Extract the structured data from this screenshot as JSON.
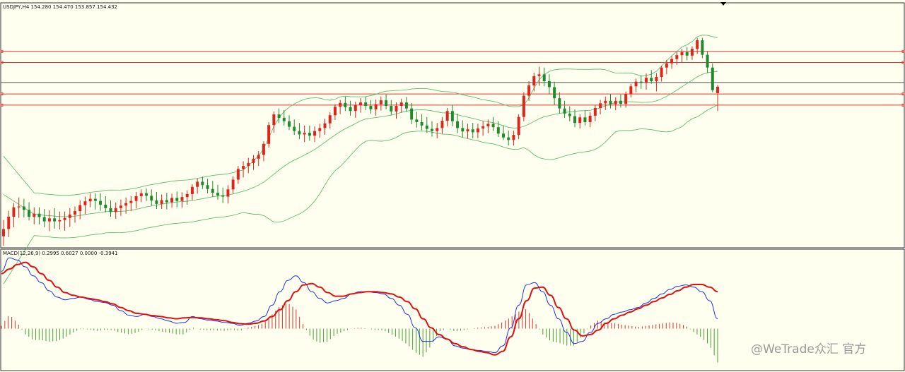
{
  "header": {
    "info": "USDJPY,H4  154.280 154.470 153.857 154.432"
  },
  "macd_label": "MACD(12,26,9) 0.2995 0.6027 0.0000 -0.3941",
  "watermark": "@WeTrade众汇 官方",
  "colors": {
    "background": "#FFFFF0",
    "bull": "#E0241B",
    "bear": "#1E8A2E",
    "band": "#5DBE6E",
    "level": "#E03030",
    "last_price": "#555555",
    "signal": "#E01010",
    "macd_line": "#2030E0",
    "hist_up": "#E03030",
    "hist_down": "#40A030"
  },
  "chart_data": [
    {
      "type": "candlestick",
      "symbol": "USDJPY",
      "timeframe": "H4",
      "ohlc_last": {
        "open": 154.28,
        "high": 154.47,
        "low": 153.857,
        "close": 154.432
      },
      "ylim": [
        150.7,
        156.3
      ],
      "overlays": [
        "bollinger-bands"
      ],
      "horizontal_levels": [
        155.26,
        155.0,
        154.26,
        154.0
      ],
      "last_price_line": 154.53,
      "candles": [
        [
          150.92,
          151.3,
          150.7,
          151.09
        ],
        [
          151.09,
          151.52,
          150.9,
          151.38
        ],
        [
          151.38,
          151.7,
          151.13,
          151.6
        ],
        [
          151.6,
          151.83,
          151.35,
          151.62
        ],
        [
          151.62,
          151.8,
          151.36,
          151.54
        ],
        [
          151.54,
          151.72,
          151.29,
          151.38
        ],
        [
          151.38,
          151.6,
          151.2,
          151.45
        ],
        [
          151.45,
          151.6,
          151.2,
          151.37
        ],
        [
          151.37,
          151.56,
          151.13,
          151.27
        ],
        [
          151.27,
          151.53,
          151.04,
          151.34
        ],
        [
          151.34,
          151.58,
          151.1,
          151.27
        ],
        [
          151.27,
          151.5,
          151.08,
          151.3
        ],
        [
          151.3,
          151.5,
          151.05,
          151.35
        ],
        [
          151.35,
          151.58,
          151.14,
          151.43
        ],
        [
          151.43,
          151.62,
          151.24,
          151.51
        ],
        [
          151.51,
          151.76,
          151.32,
          151.65
        ],
        [
          151.65,
          151.85,
          151.44,
          151.74
        ],
        [
          151.74,
          151.93,
          151.6,
          151.8
        ],
        [
          151.8,
          151.93,
          151.55,
          151.75
        ],
        [
          151.75,
          151.93,
          151.52,
          151.66
        ],
        [
          151.66,
          151.86,
          151.48,
          151.58
        ],
        [
          151.58,
          151.76,
          151.38,
          151.49
        ],
        [
          151.49,
          151.71,
          151.33,
          151.58
        ],
        [
          151.58,
          151.78,
          151.4,
          151.64
        ],
        [
          151.64,
          151.83,
          151.45,
          151.7
        ],
        [
          151.7,
          151.86,
          151.51,
          151.75
        ],
        [
          151.75,
          151.96,
          151.57,
          151.86
        ],
        [
          151.86,
          152.02,
          151.72,
          151.93
        ],
        [
          151.93,
          152.04,
          151.75,
          151.87
        ],
        [
          151.87,
          152.02,
          151.64,
          151.76
        ],
        [
          151.76,
          151.96,
          151.56,
          151.68
        ],
        [
          151.68,
          151.9,
          151.56,
          151.77
        ],
        [
          151.77,
          151.94,
          151.55,
          151.72
        ],
        [
          151.72,
          151.92,
          151.59,
          151.82
        ],
        [
          151.82,
          151.97,
          151.6,
          151.75
        ],
        [
          151.75,
          151.95,
          151.59,
          151.84
        ],
        [
          151.84,
          152.0,
          151.66,
          151.91
        ],
        [
          151.91,
          152.14,
          151.77,
          152.08
        ],
        [
          152.08,
          152.28,
          151.92,
          152.2
        ],
        [
          152.2,
          152.32,
          152.03,
          152.12
        ],
        [
          152.12,
          152.27,
          151.93,
          152.03
        ],
        [
          152.03,
          152.22,
          151.84,
          151.94
        ],
        [
          151.94,
          152.13,
          151.78,
          151.88
        ],
        [
          151.88,
          152.06,
          151.7,
          151.85
        ],
        [
          151.85,
          152.12,
          151.69,
          152.02
        ],
        [
          152.02,
          152.33,
          151.92,
          152.25
        ],
        [
          152.25,
          152.57,
          152.15,
          152.5
        ],
        [
          152.5,
          152.68,
          152.3,
          152.57
        ],
        [
          152.57,
          152.76,
          152.4,
          152.64
        ],
        [
          152.64,
          152.83,
          152.48,
          152.74
        ],
        [
          152.74,
          152.92,
          152.57,
          152.83
        ],
        [
          152.83,
          153.15,
          152.68,
          153.09
        ],
        [
          153.09,
          153.6,
          153.0,
          153.53
        ],
        [
          153.53,
          153.85,
          153.35,
          153.78
        ],
        [
          153.78,
          153.92,
          153.58,
          153.7
        ],
        [
          153.7,
          153.88,
          153.52,
          153.62
        ],
        [
          153.62,
          153.76,
          153.41,
          153.49
        ],
        [
          153.49,
          153.66,
          153.3,
          153.39
        ],
        [
          153.39,
          153.58,
          153.2,
          153.31
        ],
        [
          153.31,
          153.52,
          153.13,
          153.35
        ],
        [
          153.35,
          153.52,
          153.16,
          153.28
        ],
        [
          153.28,
          153.5,
          153.13,
          153.39
        ],
        [
          153.39,
          153.56,
          153.23,
          153.46
        ],
        [
          153.46,
          153.68,
          153.3,
          153.57
        ],
        [
          153.57,
          153.83,
          153.45,
          153.76
        ],
        [
          153.76,
          154.02,
          153.65,
          153.96
        ],
        [
          153.96,
          154.12,
          153.79,
          154.05
        ],
        [
          154.05,
          154.2,
          153.86,
          153.95
        ],
        [
          153.95,
          154.1,
          153.75,
          153.86
        ],
        [
          153.86,
          154.08,
          153.7,
          154.0
        ],
        [
          154.0,
          154.16,
          153.82,
          154.06
        ],
        [
          154.06,
          154.2,
          153.88,
          153.98
        ],
        [
          153.98,
          154.12,
          153.8,
          153.9
        ],
        [
          153.9,
          154.13,
          153.75,
          154.02
        ],
        [
          154.02,
          154.2,
          153.87,
          154.11
        ],
        [
          154.11,
          154.25,
          153.9,
          153.98
        ],
        [
          153.98,
          154.12,
          153.77,
          153.85
        ],
        [
          153.85,
          154.06,
          153.68,
          153.98
        ],
        [
          153.98,
          154.15,
          153.82,
          154.06
        ],
        [
          154.06,
          154.19,
          153.84,
          153.92
        ],
        [
          153.92,
          154.05,
          153.55,
          153.66
        ],
        [
          153.66,
          153.84,
          153.47,
          153.6
        ],
        [
          153.6,
          153.78,
          153.41,
          153.52
        ],
        [
          153.52,
          153.72,
          153.35,
          153.44
        ],
        [
          153.44,
          153.62,
          153.26,
          153.39
        ],
        [
          153.39,
          153.58,
          153.22,
          153.46
        ],
        [
          153.46,
          153.72,
          153.33,
          153.63
        ],
        [
          153.63,
          153.93,
          153.5,
          153.86
        ],
        [
          153.86,
          154.0,
          153.5,
          153.62
        ],
        [
          153.62,
          153.8,
          153.34,
          153.46
        ],
        [
          153.46,
          153.64,
          153.24,
          153.38
        ],
        [
          153.38,
          153.56,
          153.22,
          153.43
        ],
        [
          153.43,
          153.58,
          153.22,
          153.36
        ],
        [
          153.36,
          153.56,
          153.22,
          153.45
        ],
        [
          153.45,
          153.62,
          153.28,
          153.5
        ],
        [
          153.5,
          153.66,
          153.34,
          153.56
        ],
        [
          153.56,
          153.72,
          153.39,
          153.48
        ],
        [
          153.48,
          153.62,
          153.25,
          153.33
        ],
        [
          153.33,
          153.52,
          153.18,
          153.24
        ],
        [
          153.24,
          153.4,
          153.05,
          153.18
        ],
        [
          153.18,
          153.4,
          153.05,
          153.3
        ],
        [
          153.3,
          153.78,
          153.2,
          153.72
        ],
        [
          153.72,
          154.3,
          153.62,
          154.22
        ],
        [
          154.22,
          154.56,
          154.1,
          154.46
        ],
        [
          154.46,
          154.76,
          154.32,
          154.68
        ],
        [
          154.68,
          154.9,
          154.45,
          154.72
        ],
        [
          154.72,
          154.88,
          154.44,
          154.56
        ],
        [
          154.56,
          154.72,
          154.25,
          154.42
        ],
        [
          154.42,
          154.55,
          154.0,
          154.16
        ],
        [
          154.16,
          154.3,
          153.8,
          153.92
        ],
        [
          153.92,
          154.1,
          153.7,
          153.8
        ],
        [
          153.8,
          153.97,
          153.62,
          153.74
        ],
        [
          153.74,
          153.9,
          153.48,
          153.58
        ],
        [
          153.58,
          153.78,
          153.45,
          153.71
        ],
        [
          153.71,
          153.88,
          153.52,
          153.6
        ],
        [
          153.6,
          153.84,
          153.48,
          153.75
        ],
        [
          153.75,
          154.0,
          153.62,
          153.93
        ],
        [
          153.93,
          154.12,
          153.78,
          154.04
        ],
        [
          154.04,
          154.2,
          153.88,
          154.1
        ],
        [
          154.1,
          154.26,
          153.92,
          154.02
        ],
        [
          154.02,
          154.18,
          153.88,
          154.1
        ],
        [
          154.1,
          154.25,
          153.94,
          154.03
        ],
        [
          154.03,
          154.32,
          153.94,
          154.26
        ],
        [
          154.26,
          154.5,
          154.18,
          154.44
        ],
        [
          154.44,
          154.62,
          154.3,
          154.55
        ],
        [
          154.55,
          154.7,
          154.38,
          154.52
        ],
        [
          154.52,
          154.74,
          154.36,
          154.64
        ],
        [
          154.64,
          154.82,
          154.5,
          154.56
        ],
        [
          154.56,
          154.75,
          154.32,
          154.66
        ],
        [
          154.66,
          154.92,
          154.55,
          154.88
        ],
        [
          154.88,
          155.06,
          154.72,
          154.98
        ],
        [
          154.98,
          155.15,
          154.85,
          155.08
        ],
        [
          155.08,
          155.25,
          154.94,
          155.17
        ],
        [
          155.17,
          155.32,
          155.0,
          155.24
        ],
        [
          155.24,
          155.36,
          155.05,
          155.16
        ],
        [
          155.16,
          155.38,
          155.06,
          155.32
        ],
        [
          155.32,
          155.58,
          155.2,
          155.52
        ],
        [
          155.52,
          155.58,
          155.1,
          155.18
        ],
        [
          155.18,
          155.26,
          154.75,
          154.88
        ],
        [
          154.88,
          154.98,
          154.3,
          154.35
        ],
        [
          154.28,
          154.47,
          153.86,
          154.43
        ]
      ],
      "bollinger": {
        "upper_start": 152.8,
        "middle_start": 151.9,
        "lower_start": 149.8,
        "upper_end": 155.9,
        "middle_end": 155.1,
        "lower_end": 154.3
      }
    },
    {
      "type": "macd",
      "params": "12,26,9",
      "values": {
        "macd": 0.2995,
        "signal": 0.6027,
        "zero": 0.0,
        "histogram": -0.3941
      },
      "ylim": [
        -1.1,
        1.4
      ],
      "macd_line": [
        1.05,
        1.35,
        1.3,
        1.15,
        0.95,
        0.8,
        0.62,
        0.48,
        0.42,
        0.45,
        0.48,
        0.43,
        0.38,
        0.36,
        0.3,
        0.18,
        0.08,
        0.05,
        0.1,
        0.05,
        0.0,
        -0.05,
        -0.1,
        -0.08,
        0.05,
        0.0,
        -0.03,
        -0.05,
        -0.08,
        -0.1,
        -0.15,
        -0.1,
        -0.05,
        0.05,
        0.3,
        0.6,
        0.85,
        0.95,
        0.8,
        0.6,
        0.45,
        0.35,
        0.4,
        0.45,
        0.55,
        0.6,
        0.6,
        0.58,
        0.55,
        0.45,
        0.3,
        0.1,
        -0.2,
        -0.5,
        -0.5,
        -0.4,
        -0.45,
        -0.6,
        -0.65,
        -0.68,
        -0.7,
        -0.72,
        -0.75,
        -0.6,
        -0.2,
        0.3,
        0.75,
        0.8,
        0.6,
        0.3,
        0.0,
        -0.3,
        -0.55,
        -0.5,
        -0.3,
        -0.1,
        0.0,
        0.1,
        0.15,
        0.2,
        0.25,
        0.35,
        0.45,
        0.55,
        0.65,
        0.72,
        0.75,
        0.7,
        0.6,
        0.4,
        0.0
      ],
      "signal_line": [
        1.0,
        1.1,
        1.2,
        1.25,
        1.15,
        1.0,
        0.85,
        0.7,
        0.58,
        0.52,
        0.48,
        0.45,
        0.42,
        0.38,
        0.33,
        0.25,
        0.18,
        0.12,
        0.1,
        0.07,
        0.05,
        0.02,
        0.0,
        0.02,
        0.03,
        0.02,
        0.0,
        -0.02,
        -0.04,
        -0.08,
        -0.11,
        -0.12,
        -0.1,
        -0.05,
        0.05,
        0.2,
        0.4,
        0.6,
        0.75,
        0.78,
        0.7,
        0.58,
        0.5,
        0.5,
        0.55,
        0.58,
        0.6,
        0.6,
        0.58,
        0.55,
        0.48,
        0.38,
        0.22,
        0.0,
        -0.2,
        -0.35,
        -0.45,
        -0.55,
        -0.62,
        -0.68,
        -0.72,
        -0.75,
        -0.8,
        -0.72,
        -0.4,
        0.0,
        0.4,
        0.68,
        0.7,
        0.52,
        0.25,
        0.0,
        -0.25,
        -0.38,
        -0.35,
        -0.25,
        -0.1,
        0.0,
        0.08,
        0.15,
        0.22,
        0.3,
        0.38,
        0.46,
        0.54,
        0.62,
        0.7,
        0.76,
        0.76,
        0.7,
        0.6
      ]
    }
  ]
}
